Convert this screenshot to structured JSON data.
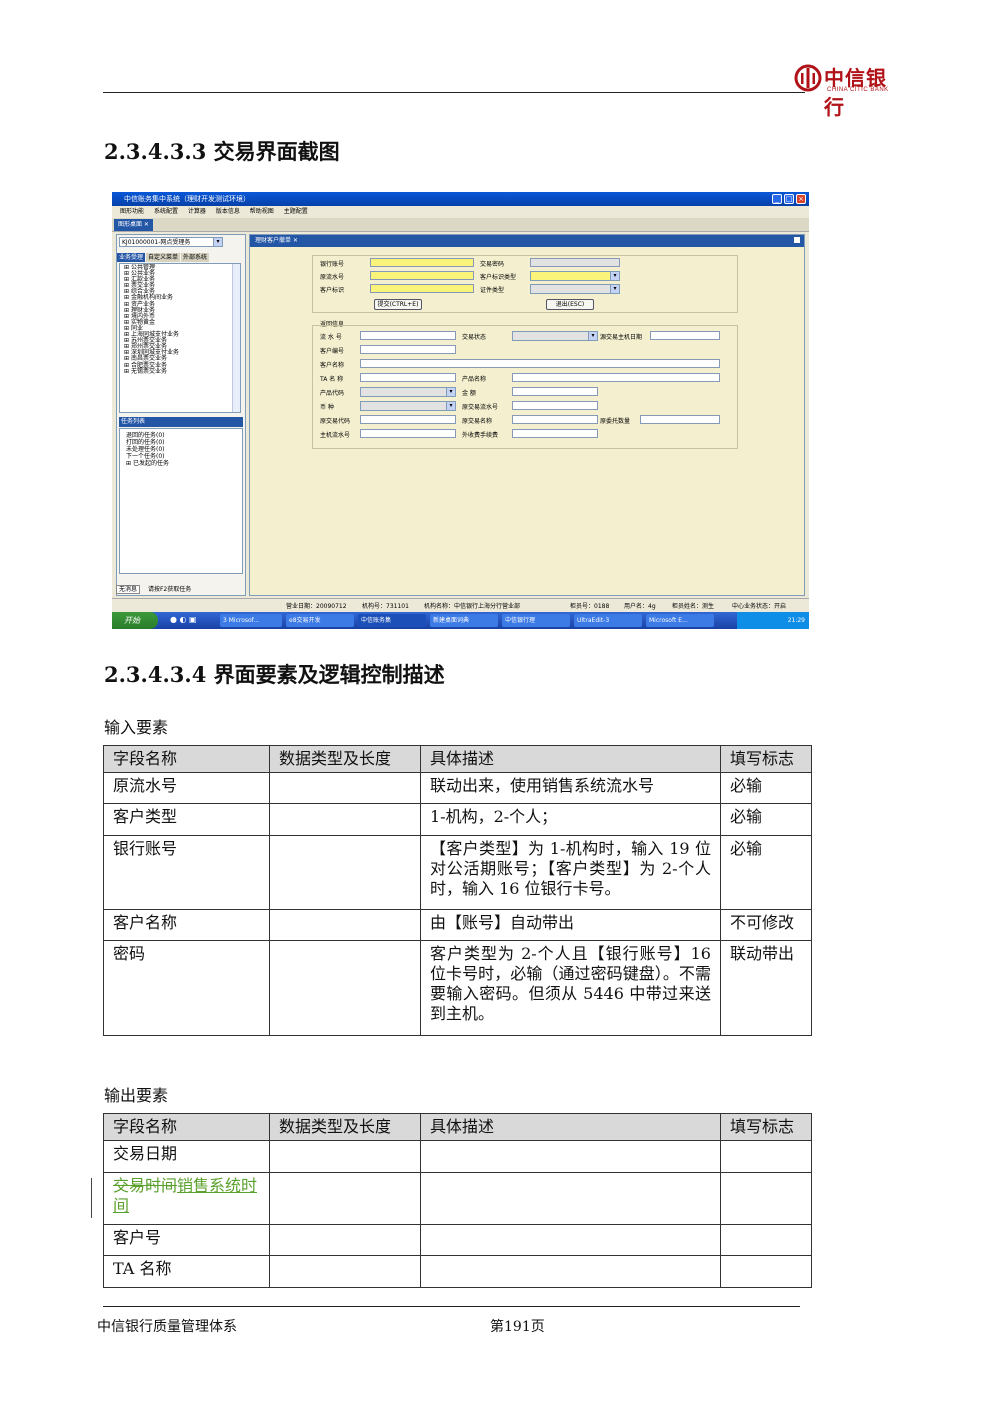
{
  "header": {
    "logo_cn": "中信银行",
    "logo_en": "CHINA CITIC BANK"
  },
  "section1": {
    "title": "2.3.4.3.3 交易界面截图"
  },
  "screenshot": {
    "window_title": "中信账务集中系统（理财开发测试环境）",
    "menus": [
      "图形功能",
      "系统配置",
      "计算器",
      "版本信息",
      "帮助视图",
      "主题配置"
    ],
    "main_tab": "图形桌面",
    "branch_select": "KJ01000001-网点受理务",
    "nav_tabs": [
      "业务受理",
      "自定义菜单",
      "外部系统"
    ],
    "tree_items": [
      "公共管理",
      "公共业务",
      "汇款业务",
      "票交业务",
      "综合业务",
      "金融机构间业务",
      "资产业务",
      "理财业务",
      "境内外币",
      "实物黄金",
      "同业",
      "上海同城支付业务",
      "苏州票交业务",
      "郑州票交业务",
      "深圳同城支付业务",
      "南昌票交业务",
      "合肥票交业务",
      "无锡票交业务"
    ],
    "task_header": "任务列表",
    "task_items": [
      "退回的任务(0)",
      "打回的任务(0)",
      "未处理任务(0)",
      "下一个任务(0)",
      "已发起的任务"
    ],
    "left_status": {
      "msg": "无消息",
      "hint": "请按F2获取任务"
    },
    "form_tab": "理财客户撤单",
    "form": {
      "bank_account": "银行账号",
      "trans_pwd": "交易密码",
      "orig_serial": "原流水号",
      "cust_id_type": "客户标识类型",
      "cust_id": "客户标识",
      "cert_type": "证件类型",
      "submit": "提交(CTRL+E)",
      "exit": "退出(ESC)",
      "group": "返回信息",
      "serial": "流 水 号",
      "trans_status": "交易状态",
      "src_host_date": "源交易主机日期",
      "cust_no": "客户编号",
      "cust_name": "客户名称",
      "ta_name": "TA 名 称",
      "product_name": "产品名称",
      "product_code": "产品代码",
      "amount": "金 额",
      "currency": "币 种",
      "src_serial": "原交易流水号",
      "src_code": "原交易代码",
      "src_name": "原交易名称",
      "src_fee_shares": "原委托数量",
      "host_serial": "主机流水号",
      "ext_fee": "外收费手续费"
    },
    "statusbar": [
      "营业日期：20090712",
      "机构号：731101",
      "机构名称：中信银行上海分行营业部",
      "柜员号：0188",
      "用户名：4g",
      "柜员姓名：测生",
      "中心业务状态：开启"
    ],
    "taskbar": {
      "start": "开始",
      "items": [
        "3 Microsof...",
        "e8交易开发",
        "中信账务集",
        "新建桌面词典",
        "中信银行理",
        "UltraEdit-3",
        "Microsoft E..."
      ],
      "clock": "21:29"
    }
  },
  "section2": {
    "title": "2.3.4.3.4 界面要素及逻辑控制描述"
  },
  "input_label": "输入要素",
  "input_table": {
    "headers": [
      "字段名称",
      "数据类型及长度",
      "具体描述",
      "填写标志"
    ],
    "rows": [
      [
        "原流水号",
        "",
        "联动出来，使用销售系统流水号",
        "必输"
      ],
      [
        "客户类型",
        "",
        "1-机构，2-个人；",
        "必输"
      ],
      [
        "银行账号",
        "",
        "【客户类型】为 1-机构时，输入 19 位对公活期账号；【客户类型】为 2-个人时，输入 16 位银行卡号。",
        "必输"
      ],
      [
        "客户名称",
        "",
        "由【账号】自动带出",
        "不可修改"
      ],
      [
        "密码",
        "",
        "客户类型为 2-个人且【银行账号】16 位卡号时，必输（通过密码键盘）。不需要输入密码。但须从 5446 中带过来送到主机。",
        "联动带出"
      ]
    ]
  },
  "output_label": "输出要素",
  "output_table": {
    "headers": [
      "字段名称",
      "数据类型及长度",
      "具体描述",
      "填写标志"
    ],
    "rows": [
      {
        "name": "交易日期"
      },
      {
        "name_deleted": "交易时间",
        "name_inserted": "销售系统时间"
      },
      {
        "name": "客户号"
      },
      {
        "name": "TA 名称"
      }
    ]
  },
  "footer": {
    "left": "中信银行质量管理体系",
    "page": "第191页"
  }
}
